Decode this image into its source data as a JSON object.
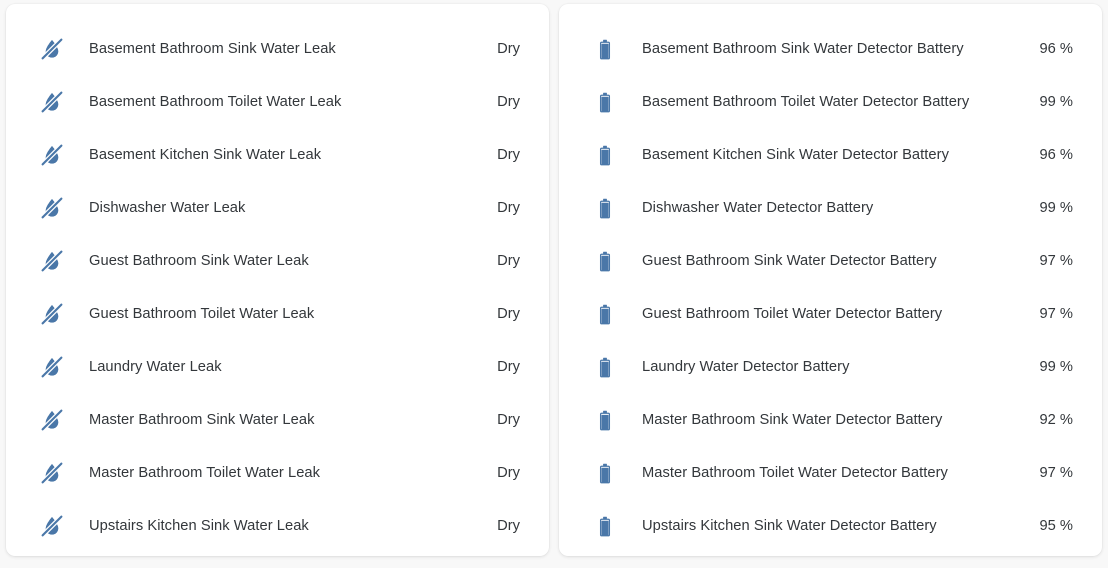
{
  "theme": {
    "page_background": "#f8f8f8",
    "card_background": "#ffffff",
    "icon_color": "#4a77a8",
    "text_color": "#33373b"
  },
  "panels": [
    {
      "name": "water-leak-sensors",
      "icon": "water-drop-slash-icon",
      "rows": [
        {
          "label": "Basement Bathroom Sink Water Leak",
          "value": "Dry"
        },
        {
          "label": "Basement Bathroom Toilet Water Leak",
          "value": "Dry"
        },
        {
          "label": "Basement Kitchen Sink Water Leak",
          "value": "Dry"
        },
        {
          "label": "Dishwasher Water Leak",
          "value": "Dry"
        },
        {
          "label": "Guest Bathroom Sink Water Leak",
          "value": "Dry"
        },
        {
          "label": "Guest Bathroom Toilet Water Leak",
          "value": "Dry"
        },
        {
          "label": "Laundry Water Leak",
          "value": "Dry"
        },
        {
          "label": "Master Bathroom Sink Water Leak",
          "value": "Dry"
        },
        {
          "label": "Master Bathroom Toilet Water Leak",
          "value": "Dry"
        },
        {
          "label": "Upstairs Kitchen Sink Water Leak",
          "value": "Dry"
        }
      ]
    },
    {
      "name": "water-detector-batteries",
      "icon": "battery-icon",
      "rows": [
        {
          "label": "Basement Bathroom Sink Water Detector Battery",
          "value": "96 %",
          "level": 96
        },
        {
          "label": "Basement Bathroom Toilet Water Detector Battery",
          "value": "99 %",
          "level": 99
        },
        {
          "label": "Basement Kitchen Sink Water Detector Battery",
          "value": "96 %",
          "level": 96
        },
        {
          "label": "Dishwasher Water Detector Battery",
          "value": "99 %",
          "level": 99
        },
        {
          "label": "Guest Bathroom Sink Water Detector Battery",
          "value": "97 %",
          "level": 97
        },
        {
          "label": "Guest Bathroom Toilet Water Detector Battery",
          "value": "97 %",
          "level": 97
        },
        {
          "label": "Laundry Water Detector Battery",
          "value": "99 %",
          "level": 99
        },
        {
          "label": "Master Bathroom Sink Water Detector Battery",
          "value": "92 %",
          "level": 92
        },
        {
          "label": "Master Bathroom Toilet Water Detector Battery",
          "value": "97 %",
          "level": 97
        },
        {
          "label": "Upstairs Kitchen Sink Water Detector Battery",
          "value": "95 %",
          "level": 95
        }
      ]
    }
  ]
}
